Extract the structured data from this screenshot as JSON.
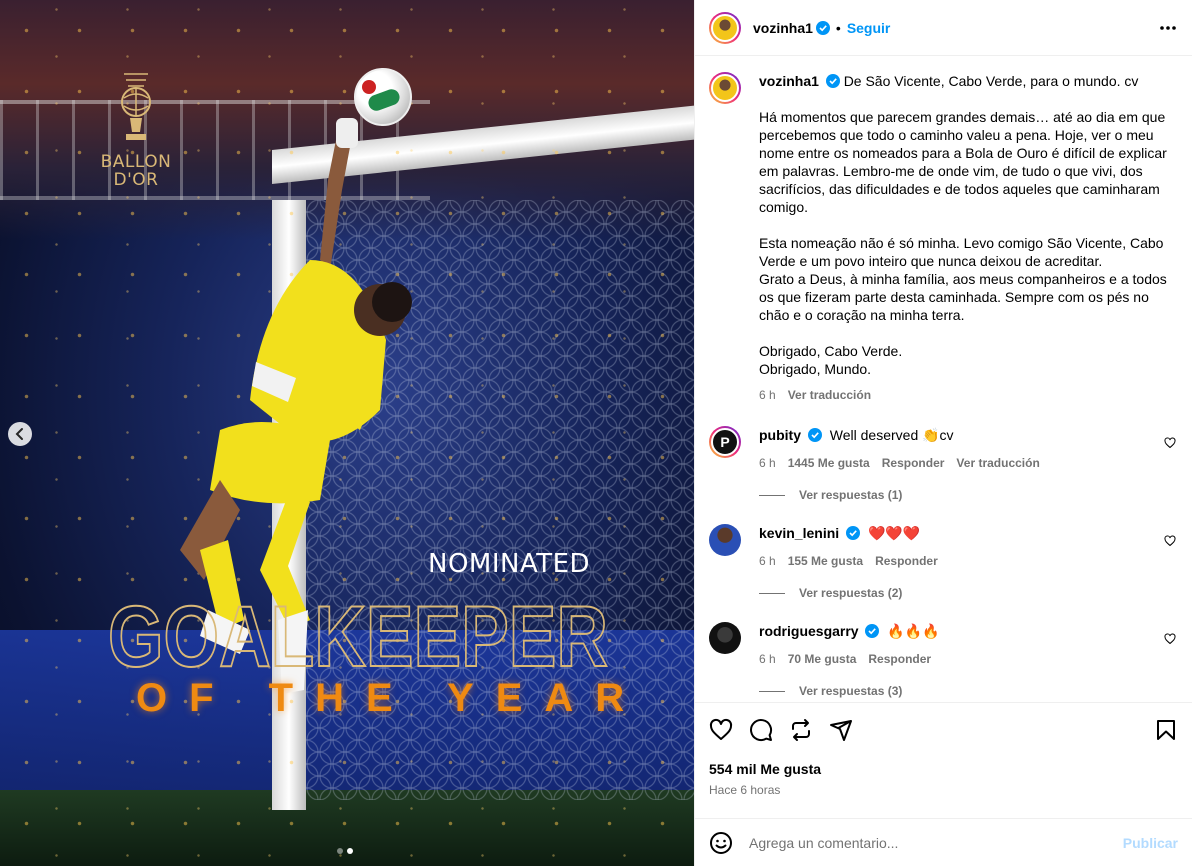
{
  "media": {
    "logo_text": "BALLON D'OR",
    "nominated": "NOMINATED",
    "headline": "GOALKEEPER",
    "subheadline": "OF THE YEAR",
    "carousel_total": 2,
    "carousel_active": 2
  },
  "header": {
    "username": "vozinha1",
    "separator": "•",
    "follow_label": "Seguir"
  },
  "caption": {
    "username": "vozinha1",
    "first_line": "De São Vicente, Cabo Verde, para o mundo. cv",
    "body": "Há momentos que parecem grandes demais… até ao dia em que percebemos que todo o caminho valeu a pena. Hoje, ver o meu nome entre os nomeados para a Bola de Ouro é difícil de explicar em palavras. Lembro-me de onde vim, de tudo o que vivi, dos sacrifícios, das dificuldades e de todos aqueles que caminharam comigo.\n\nEsta nomeação não é só minha. Levo comigo São Vicente, Cabo Verde e um povo inteiro que nunca deixou de acreditar.\nGrato a Deus, à minha família, aos meus companheiros e a todos os que fizeram parte desta caminhada. Sempre com os pés no chão e o coração na minha terra.\n\nObrigado, Cabo Verde.\nObrigado, Mundo.",
    "time": "6 h",
    "translate_label": "Ver traducción"
  },
  "comments": [
    {
      "username": "pubity",
      "text": "Well deserved 👏cv",
      "time": "6 h",
      "likes": "1445 Me gusta",
      "reply_label": "Responder",
      "translate_label": "Ver traducción",
      "replies_label": "Ver respuestas (1)"
    },
    {
      "username": "kevin_lenini",
      "text": "❤️❤️❤️",
      "time": "6 h",
      "likes": "155 Me gusta",
      "reply_label": "Responder",
      "replies_label": "Ver respuestas (2)"
    },
    {
      "username": "rodriguesgarry",
      "text": "🔥🔥🔥",
      "time": "6 h",
      "likes": "70 Me gusta",
      "reply_label": "Responder",
      "replies_label": "Ver respuestas (3)"
    }
  ],
  "footer": {
    "likes": "554 mil Me gusta",
    "time_ago": "Hace 6 horas",
    "comment_placeholder": "Agrega un comentario...",
    "post_label": "Publicar"
  },
  "icons": {
    "verified": "verified-badge-icon",
    "more": "more-options-icon",
    "like": "heart-icon",
    "comment": "comment-bubble-icon",
    "repost": "repost-icon",
    "share": "share-paper-plane-icon",
    "save": "bookmark-icon",
    "emoji": "emoji-icon",
    "prev": "chevron-left-icon"
  },
  "colors": {
    "accent": "#0095f6",
    "post_disabled": "#b3dbff",
    "muted": "#737373",
    "title_gold": "#d9b877",
    "title_orange": "#ef8a12"
  }
}
